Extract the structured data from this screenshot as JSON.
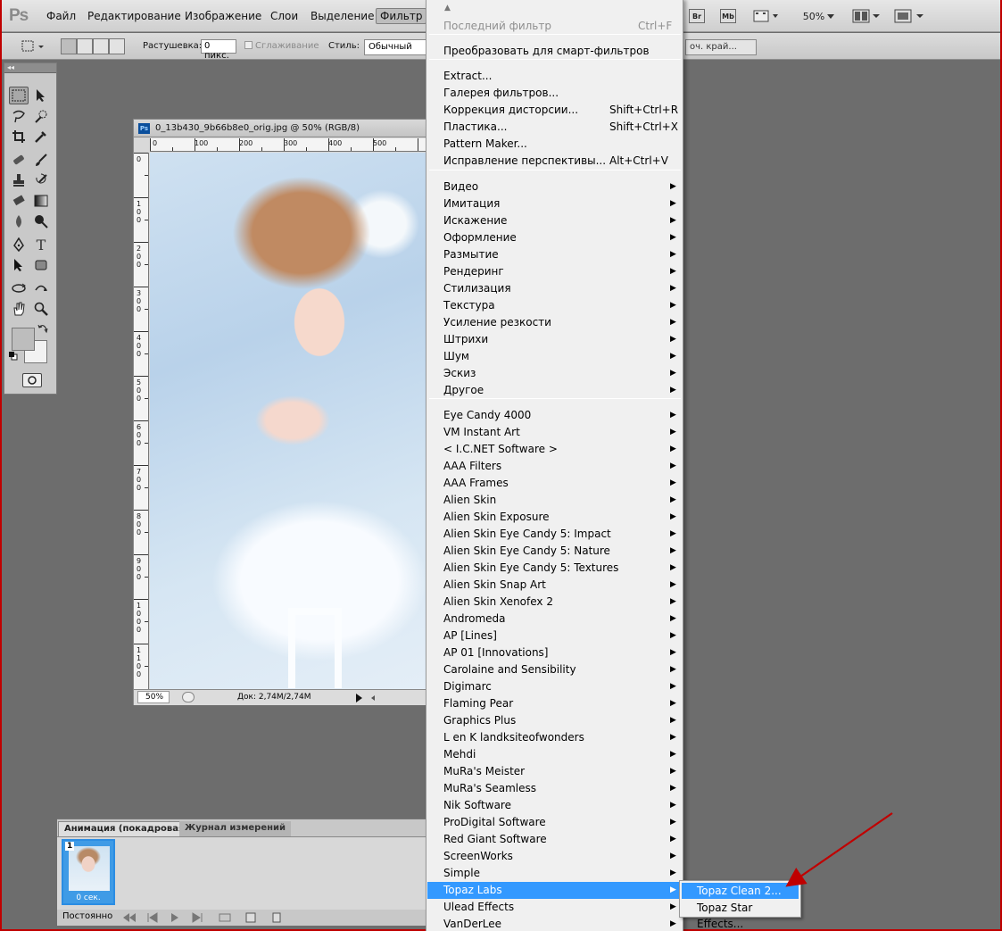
{
  "app": {
    "logo": "Ps",
    "menus": [
      "Файл",
      "Редактирование",
      "Изображение",
      "Слои",
      "Выделение",
      "Фильтр"
    ],
    "right_buttons": [
      "Br",
      "Mb"
    ],
    "zoom": "50%"
  },
  "options_bar": {
    "feather_label": "Растушевка:",
    "feather_value": "0 пикс.",
    "antialias_label": "Сглаживание",
    "style_label": "Стиль:",
    "style_value": "Обычный",
    "refine_edge_partial": "оч. край..."
  },
  "document": {
    "title": "0_13b430_9b66b8e0_orig.jpg @ 50% (RGB/8)",
    "ruler_h": [
      "0",
      "100",
      "200",
      "300",
      "400",
      "500"
    ],
    "ruler_v": [
      "0",
      "1\n0\n0",
      "2\n0\n0",
      "3\n0\n0",
      "4\n0\n0",
      "5\n0\n0",
      "6\n0\n0",
      "7\n0\n0",
      "8\n0\n0",
      "9\n0\n0",
      "1\n0\n0\n0",
      "1\n1\n0\n0"
    ],
    "zoom": "50%",
    "doc_size": "Док: 2,74M/2,74M"
  },
  "animation_panel": {
    "tab_animation": "Анимация (покадровая)",
    "tab_measure": "Журнал измерений",
    "frame_number": "1",
    "frame_time": "0 сек.",
    "loop": "Постоянно"
  },
  "filter_menu": {
    "items": [
      {
        "label": "Последний фильтр",
        "shortcut": "Ctrl+F",
        "dim": true
      },
      {
        "label": "Преобразовать для смарт-фильтров"
      },
      {
        "label": "Extract..."
      },
      {
        "label": "Галерея фильтров..."
      },
      {
        "label": "Коррекция дисторсии...",
        "shortcut": "Shift+Ctrl+R"
      },
      {
        "label": "Пластика...",
        "shortcut": "Shift+Ctrl+X"
      },
      {
        "label": "Pattern Maker..."
      },
      {
        "label": "Исправление перспективы...",
        "shortcut": "Alt+Ctrl+V"
      },
      {
        "label": "Видео",
        "sub": true
      },
      {
        "label": "Имитация",
        "sub": true
      },
      {
        "label": "Искажение",
        "sub": true
      },
      {
        "label": "Оформление",
        "sub": true
      },
      {
        "label": "Размытие",
        "sub": true
      },
      {
        "label": "Рендеринг",
        "sub": true
      },
      {
        "label": "Стилизация",
        "sub": true
      },
      {
        "label": "Текстура",
        "sub": true
      },
      {
        "label": "Усиление резкости",
        "sub": true
      },
      {
        "label": "Штрихи",
        "sub": true
      },
      {
        "label": "Шум",
        "sub": true
      },
      {
        "label": "Эскиз",
        "sub": true
      },
      {
        "label": "Другое",
        "sub": true
      },
      {
        "label": " Eye Candy 4000",
        "sub": true
      },
      {
        "label": " VM Instant Art",
        "sub": true
      },
      {
        "label": "< I.C.NET Software >",
        "sub": true
      },
      {
        "label": "AAA Filters",
        "sub": true
      },
      {
        "label": "AAA Frames",
        "sub": true
      },
      {
        "label": "Alien Skin",
        "sub": true
      },
      {
        "label": "Alien Skin Exposure",
        "sub": true
      },
      {
        "label": "Alien Skin Eye Candy 5: Impact",
        "sub": true
      },
      {
        "label": "Alien Skin Eye Candy 5: Nature",
        "sub": true
      },
      {
        "label": "Alien Skin Eye Candy 5: Textures",
        "sub": true
      },
      {
        "label": "Alien Skin Snap Art",
        "sub": true
      },
      {
        "label": "Alien Skin Xenofex 2",
        "sub": true
      },
      {
        "label": "Andromeda",
        "sub": true
      },
      {
        "label": "AP [Lines]",
        "sub": true
      },
      {
        "label": "AP 01 [Innovations]",
        "sub": true
      },
      {
        "label": "Carolaine and Sensibility",
        "sub": true
      },
      {
        "label": "Digimarc",
        "sub": true
      },
      {
        "label": "Flaming Pear",
        "sub": true
      },
      {
        "label": "Graphics Plus",
        "sub": true
      },
      {
        "label": "L en K landksiteofwonders",
        "sub": true
      },
      {
        "label": "Mehdi",
        "sub": true
      },
      {
        "label": "MuRa's Meister",
        "sub": true
      },
      {
        "label": "MuRa's Seamless",
        "sub": true
      },
      {
        "label": "Nik Software",
        "sub": true
      },
      {
        "label": "ProDigital Software",
        "sub": true
      },
      {
        "label": "Red Giant Software",
        "sub": true
      },
      {
        "label": "ScreenWorks",
        "sub": true
      },
      {
        "label": "Simple",
        "sub": true
      },
      {
        "label": "Topaz Labs",
        "sub": true,
        "highlighted": true
      },
      {
        "label": "Ulead Effects",
        "sub": true
      },
      {
        "label": "VanDerLee",
        "sub": true
      }
    ]
  },
  "submenu": {
    "items": [
      {
        "label": "Topaz Clean 2...",
        "highlighted": true
      },
      {
        "label": "Topaz Star Effects..."
      }
    ]
  },
  "colors": {
    "menu_highlight": "#3399ff",
    "annotation_arrow": "#c00000"
  }
}
